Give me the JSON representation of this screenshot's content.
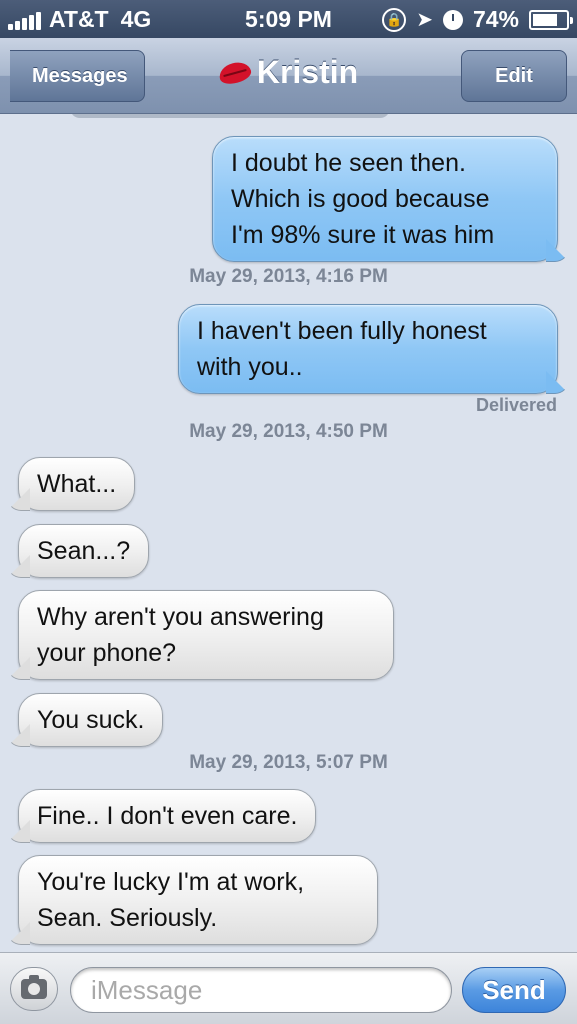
{
  "status_bar": {
    "carrier": "AT&T",
    "network": "4G",
    "time": "5:09 PM",
    "battery": "74%",
    "battery_level": 0.74,
    "icons": [
      "signal-icon",
      "rotation-lock-icon",
      "location-icon",
      "alarm-icon",
      "battery-icon"
    ]
  },
  "nav": {
    "back_label": "Messages",
    "title": "Kristin",
    "title_icon": "lips-icon",
    "edit_label": "Edit"
  },
  "messages": [
    {
      "type": "out",
      "text": "I doubt he seen then.\nWhich is good because\nI'm 98% sure it was him"
    },
    {
      "type": "timestamp",
      "text": "May 29, 2013, 4:16 PM"
    },
    {
      "type": "out",
      "text": "I haven't been fully honest\nwith you.."
    },
    {
      "type": "status",
      "text": "Delivered"
    },
    {
      "type": "timestamp",
      "text": "May 29, 2013, 4:50 PM"
    },
    {
      "type": "in",
      "text": "What..."
    },
    {
      "type": "in",
      "text": "Sean...?"
    },
    {
      "type": "in",
      "text": "Why aren't you answering\nyour phone?"
    },
    {
      "type": "in",
      "text": "You suck."
    },
    {
      "type": "timestamp",
      "text": "May 29, 2013, 5:07 PM"
    },
    {
      "type": "in",
      "text": "Fine.. I don't even care."
    },
    {
      "type": "in",
      "text": "You're lucky I'm at work,\nSean. Seriously."
    }
  ],
  "composer": {
    "placeholder": "iMessage",
    "value": "",
    "send_label": "Send",
    "camera_icon": "camera-icon"
  },
  "colors": {
    "outgoing_bubble": "#8fc7f5",
    "incoming_bubble": "#f0f0f0",
    "background": "#dbe2ed",
    "nav_bar": "#8a9cb8",
    "send_button": "#3d84da"
  }
}
